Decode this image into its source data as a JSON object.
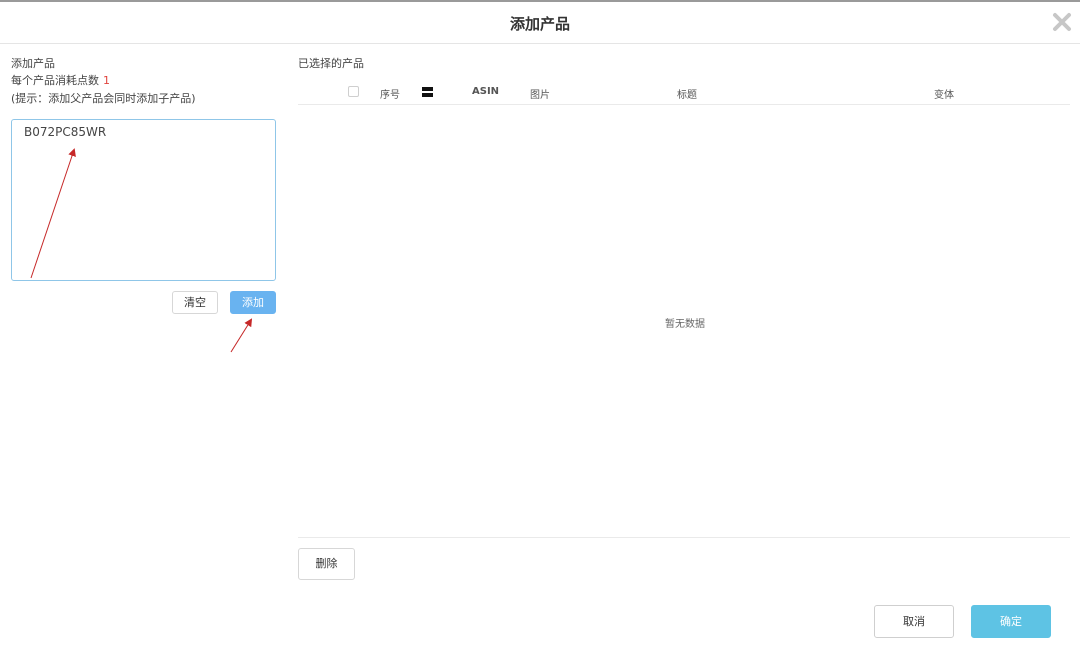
{
  "dialog": {
    "title": "添加产品",
    "close_icon": "close-icon"
  },
  "left": {
    "heading": "添加产品",
    "cost_label": "每个产品消耗点数",
    "cost_value": "1",
    "hint": "(提示：添加父产品会同时添加子产品)",
    "textarea_value": "B072PC85WR",
    "clear_label": "清空",
    "add_label": "添加"
  },
  "right": {
    "title": "已选择的产品",
    "columns": [
      "序号",
      "ASIN",
      "图片",
      "标题",
      "变体"
    ],
    "sort_icon": "sort-icon",
    "empty_text": "暂无数据",
    "delete_label": "删除"
  },
  "footer": {
    "cancel_label": "取消",
    "confirm_label": "确定"
  },
  "colors": {
    "accent": "#69b3f0",
    "confirm": "#5ec3e4",
    "highlight": "#e0433d",
    "arrow": "#c62828"
  }
}
